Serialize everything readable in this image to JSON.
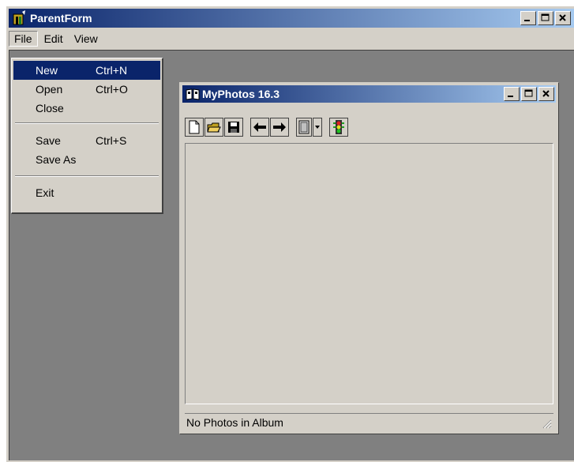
{
  "parent": {
    "title": "ParentForm",
    "menu": [
      {
        "label": "File"
      },
      {
        "label": "Edit"
      },
      {
        "label": "View"
      }
    ]
  },
  "file_menu": {
    "items": [
      {
        "label": "New",
        "shortcut": "Ctrl+N"
      },
      {
        "label": "Open",
        "shortcut": "Ctrl+O"
      },
      {
        "label": "Close",
        "shortcut": ""
      },
      {
        "label": "Save",
        "shortcut": "Ctrl+S"
      },
      {
        "label": "Save As",
        "shortcut": ""
      },
      {
        "label": "Exit",
        "shortcut": ""
      }
    ]
  },
  "child": {
    "title": "MyPhotos 16.3",
    "status": "No Photos in Album"
  },
  "colors": {
    "titlebar_start": "#0a246a",
    "titlebar_end": "#a6caf0",
    "face": "#d4d0c8",
    "mdi_background": "#808080",
    "highlight": "#0a246a"
  }
}
